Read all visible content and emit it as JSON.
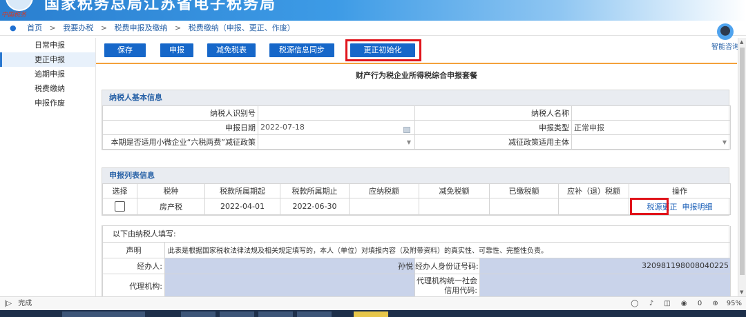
{
  "header": {
    "site_title": "国家税务总局江苏省电子税务局",
    "brand_script": "中国税务"
  },
  "breadcrumb": {
    "items": [
      "首页",
      "我要办税",
      "税费申报及缴纳",
      "税费缴纳（申报、更正、作废）"
    ],
    "separator": ">"
  },
  "assistant": {
    "label": "智能咨询"
  },
  "sidebar": {
    "items": [
      {
        "label": "日常申报"
      },
      {
        "label": "更正申报",
        "active": true
      },
      {
        "label": "逾期申报"
      },
      {
        "label": "税费缴纳"
      },
      {
        "label": "申报作废"
      }
    ]
  },
  "toolbar": {
    "buttons": [
      "保存",
      "申报",
      "减免税表",
      "税源信息同步",
      "更正初始化"
    ],
    "highlighted": "更正初始化"
  },
  "form_title": "财产行为税企业所得税综合申报套餐",
  "basic_info": {
    "section_title": "纳税人基本信息",
    "taxpayer_id_label": "纳税人识别号",
    "taxpayer_id": "",
    "taxpayer_name_label": "纳税人名称",
    "taxpayer_name": "",
    "declare_date_label": "申报日期",
    "declare_date": "2022-07-18",
    "declare_type_label": "申报类型",
    "declare_type": "正常申报",
    "small_biz_label": "本期是否适用小微企业“六税两费”减征政策",
    "small_biz_value": "",
    "policy_subject_label": "减征政策适用主体",
    "policy_subject_value": ""
  },
  "declare_list": {
    "section_title": "申报列表信息",
    "columns": [
      "选择",
      "税种",
      "税款所属期起",
      "税款所属期止",
      "应纳税额",
      "减免税额",
      "已缴税额",
      "应补（退）税额",
      "操作"
    ],
    "rows": [
      {
        "tax_type": "房产税",
        "period_start": "2022-04-01",
        "period_end": "2022-06-30",
        "payable": "",
        "reduced": "",
        "paid": "",
        "refund": "",
        "actions": [
          "税源更正",
          "申报明细"
        ]
      }
    ]
  },
  "declaration": {
    "intro": "以下由纳税人填写:",
    "statement_label": "声明",
    "statement_text": "此表是根据国家税收法律法规及相关规定填写的，本人（单位）对填报内容（及附带资料）的真实性、可靠性、完整性负责。",
    "handler_label": "经办人:",
    "handler_name": "孙悦",
    "handler_id_label": "经办人身份证号码:",
    "handler_id": "320981198008040225",
    "agency_label": "代理机构:",
    "agency_code_label_1": "代理机构统一社会",
    "agency_code_label_2": "信用代码:"
  },
  "statusbar": {
    "left": "完成",
    "zoom": "95%",
    "download_count": "0"
  },
  "colors": {
    "primary_button": "#1667c9",
    "highlight_border": "#e0141b",
    "accent_line": "#f3a13b",
    "section_header_bg": "#e9ecf1",
    "input_blue": "#c9d3ea"
  }
}
